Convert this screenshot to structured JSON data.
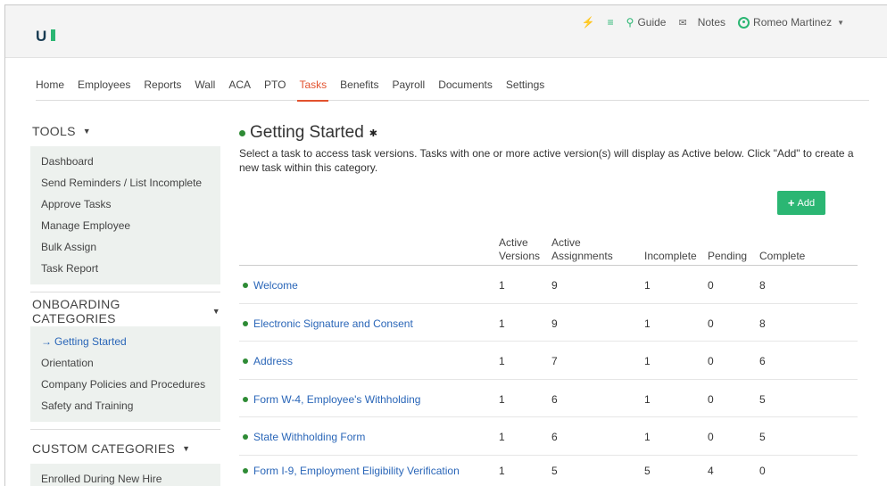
{
  "header": {
    "logo": "UI",
    "guide": "Guide",
    "notes": "Notes",
    "user": "Romeo Martinez"
  },
  "nav": {
    "tabs": [
      {
        "label": "Home"
      },
      {
        "label": "Employees"
      },
      {
        "label": "Reports"
      },
      {
        "label": "Wall"
      },
      {
        "label": "ACA"
      },
      {
        "label": "PTO"
      },
      {
        "label": "Tasks"
      },
      {
        "label": "Benefits"
      },
      {
        "label": "Payroll"
      },
      {
        "label": "Documents"
      },
      {
        "label": "Settings"
      }
    ],
    "active": "Tasks"
  },
  "sidebar": {
    "tools": {
      "title": "TOOLS",
      "items": [
        "Dashboard",
        "Send Reminders / List Incomplete",
        "Approve Tasks",
        "Manage Employee",
        "Bulk Assign",
        "Task Report"
      ]
    },
    "onboarding": {
      "title": "ONBOARDING CATEGORIES",
      "items": [
        "Getting Started",
        "Orientation",
        "Company Policies and Procedures",
        "Safety and Training"
      ],
      "current": "Getting Started"
    },
    "custom": {
      "title": "CUSTOM CATEGORIES",
      "items": [
        "Enrolled During New Hire"
      ]
    }
  },
  "main": {
    "title": "Getting Started",
    "description": "Select a task to access task versions. Tasks with one or more active version(s) will display as Active below. Click \"Add\" to create a new task within this category.",
    "add_label": "Add",
    "columns": {
      "active_versions_1": "Active",
      "active_versions_2": "Versions",
      "active_assignments_1": "Active",
      "active_assignments_2": "Assignments",
      "incomplete": "Incomplete",
      "pending": "Pending",
      "complete": "Complete"
    },
    "rows": [
      {
        "name": "Welcome",
        "active_versions": "1",
        "active_assignments": "9",
        "incomplete": "1",
        "pending": "0",
        "complete": "8"
      },
      {
        "name": "Electronic Signature and Consent",
        "active_versions": "1",
        "active_assignments": "9",
        "incomplete": "1",
        "pending": "0",
        "complete": "8"
      },
      {
        "name": "Address",
        "active_versions": "1",
        "active_assignments": "7",
        "incomplete": "1",
        "pending": "0",
        "complete": "6"
      },
      {
        "name": "Form W-4, Employee's Withholding",
        "active_versions": "1",
        "active_assignments": "6",
        "incomplete": "1",
        "pending": "0",
        "complete": "5"
      },
      {
        "name": "State Withholding Form",
        "active_versions": "1",
        "active_assignments": "6",
        "incomplete": "1",
        "pending": "0",
        "complete": "5"
      },
      {
        "name": "Form I-9, Employment Eligibility Verification",
        "active_versions": "1",
        "active_assignments": "5",
        "incomplete": "5",
        "pending": "4",
        "complete": "0"
      }
    ]
  },
  "colors": {
    "accent_green": "#2bb673",
    "active_tab": "#e2522e",
    "link_blue": "#2a66b8",
    "sidebar_bg": "#edf1ee"
  },
  "icons": {
    "top": [
      "bolt-icon",
      "server-icon",
      "map-pin-icon",
      "envelope-icon",
      "user-circle-icon"
    ]
  }
}
